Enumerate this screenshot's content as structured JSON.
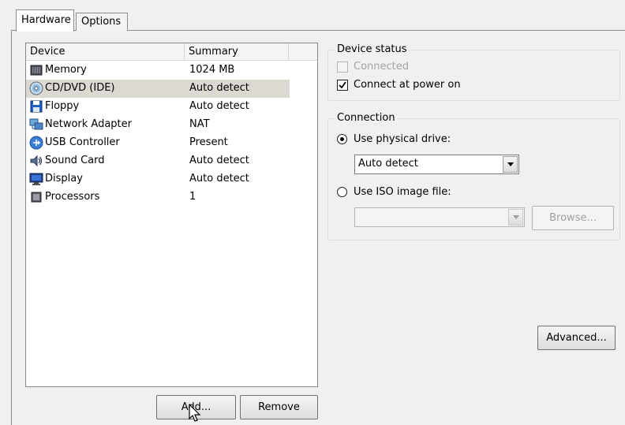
{
  "tabs": [
    {
      "label": "Hardware",
      "active": true
    },
    {
      "label": "Options",
      "active": false
    }
  ],
  "device_list": {
    "columns": {
      "device": "Device",
      "summary": "Summary"
    },
    "rows": [
      {
        "device": "Memory",
        "summary": "1024 MB",
        "icon": "memory-icon",
        "selected": false
      },
      {
        "device": "CD/DVD (IDE)",
        "summary": "Auto detect",
        "icon": "cd-dvd-icon",
        "selected": true
      },
      {
        "device": "Floppy",
        "summary": "Auto detect",
        "icon": "floppy-icon",
        "selected": false
      },
      {
        "device": "Network Adapter",
        "summary": "NAT",
        "icon": "network-adapter-icon",
        "selected": false
      },
      {
        "device": "USB Controller",
        "summary": "Present",
        "icon": "usb-icon",
        "selected": false
      },
      {
        "device": "Sound Card",
        "summary": "Auto detect",
        "icon": "sound-card-icon",
        "selected": false
      },
      {
        "device": "Display",
        "summary": "Auto detect",
        "icon": "display-icon",
        "selected": false
      },
      {
        "device": "Processors",
        "summary": "1",
        "icon": "processor-icon",
        "selected": false
      }
    ]
  },
  "buttons": {
    "add": "Add...",
    "remove": "Remove",
    "browse": "Browse...",
    "advanced": "Advanced..."
  },
  "device_status": {
    "title": "Device status",
    "connected": {
      "label": "Connected",
      "checked": false,
      "enabled": false
    },
    "connect_at_power_on": {
      "label": "Connect at power on",
      "checked": true,
      "enabled": true
    }
  },
  "connection": {
    "title": "Connection",
    "use_physical_drive": {
      "label": "Use physical drive:",
      "selected": true
    },
    "physical_drive_value": "Auto detect",
    "use_iso_image": {
      "label": "Use ISO image file:",
      "selected": false
    },
    "iso_path_value": ""
  },
  "colors": {
    "selected_row": "#dcd9d2",
    "window_bg": "#f0f0f0",
    "disabled_text": "#a3a3a3"
  }
}
